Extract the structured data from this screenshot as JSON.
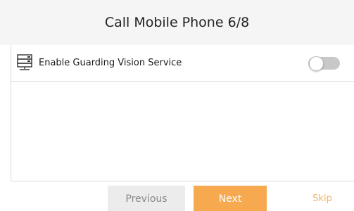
{
  "header": {
    "title": "Call Mobile Phone 6/8"
  },
  "setting": {
    "icon": "server-icon",
    "label": "Enable Guarding Vision Service",
    "toggle_on": false
  },
  "footer": {
    "previous_label": "Previous",
    "next_label": "Next",
    "skip_label": "Skip"
  },
  "colors": {
    "header_bg": "#f5f5f5",
    "accent": "#f6a94f",
    "skip_text": "#f2b36a",
    "previous_bg": "#ececec",
    "previous_text": "#8a8a8a",
    "toggle_off": "#c8c8c8"
  }
}
